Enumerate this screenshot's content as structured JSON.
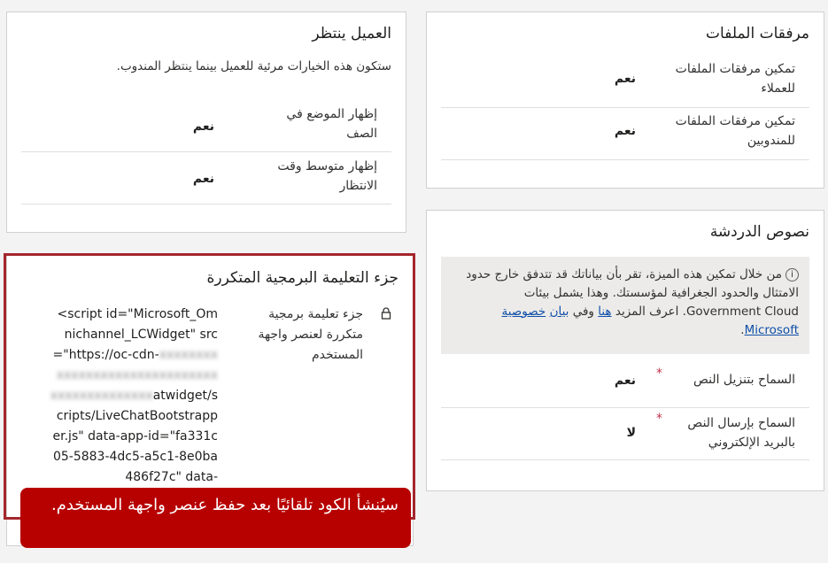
{
  "file_attachments": {
    "title": "مرفقات الملفات",
    "rows": [
      {
        "label": "تمكين مرفقات الملفات للعملاء",
        "value": "نعم"
      },
      {
        "label": "تمكين مرفقات الملفات للمندوبين",
        "value": "نعم"
      }
    ]
  },
  "customer_waiting": {
    "title": "العميل ينتظر",
    "description": "ستكون هذه الخيارات مرئية للعميل بينما ينتظر المندوب.",
    "rows": [
      {
        "label": "إظهار الموضع في الصف",
        "value": "نعم"
      },
      {
        "label": "إظهار متوسط وقت الانتظار",
        "value": "نعم"
      }
    ]
  },
  "chat_transcripts": {
    "title": "نصوص الدردشة",
    "notice": {
      "info_icon": "info-circle-icon",
      "text_1": "من خلال تمكين هذه الميزة، تقر بأن بياناتك قد تتدفق خارج حدود الامتثال والحدود الجغرافية لمؤسستك. وهذا يشمل بيئات Government Cloud. اعرف المزيد",
      "link_here": "هنا",
      "text_2": "وفي",
      "link_statement": "بيان",
      "link_privacy": "خصوصية Microsoft",
      "end": "."
    },
    "rows": [
      {
        "label": "السماح بتنزيل النص",
        "value": "نعم",
        "required": "*"
      },
      {
        "label": "السماح بإرسال النص بالبريد الإلكتروني",
        "value": "لا",
        "required": "*"
      }
    ]
  },
  "code_snippet": {
    "title": "جزء التعليمة البرمجية المتكررة",
    "lock_icon": "lock-icon",
    "label": "جزء تعليمة برمجية متكررة لعنصر واجهة المستخدم",
    "code_part_1": "<script id=\"Microsoft_Omnichannel_LCWidget\" src=\"https://oc-cdn-",
    "code_blurred": "xxxxxxxxxxxxxxxxxxxxxxxxxxxxxxxxxxxxxxxxxxxx",
    "code_part_2": "atwidget/scripts/LiveChatBootstrapper.js\" data-app-id=\"fa331c05-5883-4dc5-a5c1-8e0ba486f27c\" data-"
  },
  "toast": {
    "text": "سيُنشأ الكود تلقائيًا بعد حفظ عنصر واجهة المستخدم."
  },
  "colors": {
    "highlight_border": "#a4262c",
    "toast_bg": "#b70000",
    "link": "#0f4fa8"
  }
}
